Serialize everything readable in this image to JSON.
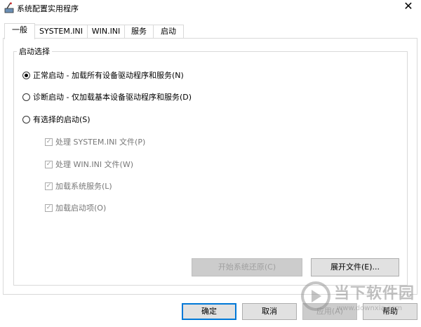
{
  "window": {
    "title": "系统配置实用程序",
    "close_glyph": "✕"
  },
  "tabs": [
    {
      "label": "一般",
      "active": true
    },
    {
      "label": "SYSTEM.INI"
    },
    {
      "label": "WIN.INI"
    },
    {
      "label": "服务"
    },
    {
      "label": "启动"
    }
  ],
  "startup_group": {
    "label": "启动选择",
    "options": [
      {
        "label": "正常启动 - 加载所有设备驱动程序和服务(N)",
        "selected": true
      },
      {
        "label": "诊断启动 - 仅加载基本设备驱动程序和服务(D)",
        "selected": false
      },
      {
        "label": "有选择的启动(S)",
        "selected": false
      }
    ],
    "sub_options": [
      {
        "label": "处理 SYSTEM.INI 文件(P)",
        "checked": true,
        "enabled": false
      },
      {
        "label": "处理 WIN.INI 文件(W)",
        "checked": true,
        "enabled": false
      },
      {
        "label": "加载系统服务(L)",
        "checked": true,
        "enabled": false
      },
      {
        "label": "加载启动项(O)",
        "checked": true,
        "enabled": false
      }
    ],
    "restore_button": "开始系统还原(C)",
    "expand_button": "展开文件(E)..."
  },
  "footer": {
    "ok": "确定",
    "cancel": "取消",
    "apply": "应用(A)",
    "help": "帮助"
  },
  "watermark": {
    "text": "当下软件园",
    "url": "www.downxia.com"
  },
  "colors": {
    "accent": "#0078d7",
    "border": "#d9d9d9",
    "button": "#e1e1e1"
  }
}
